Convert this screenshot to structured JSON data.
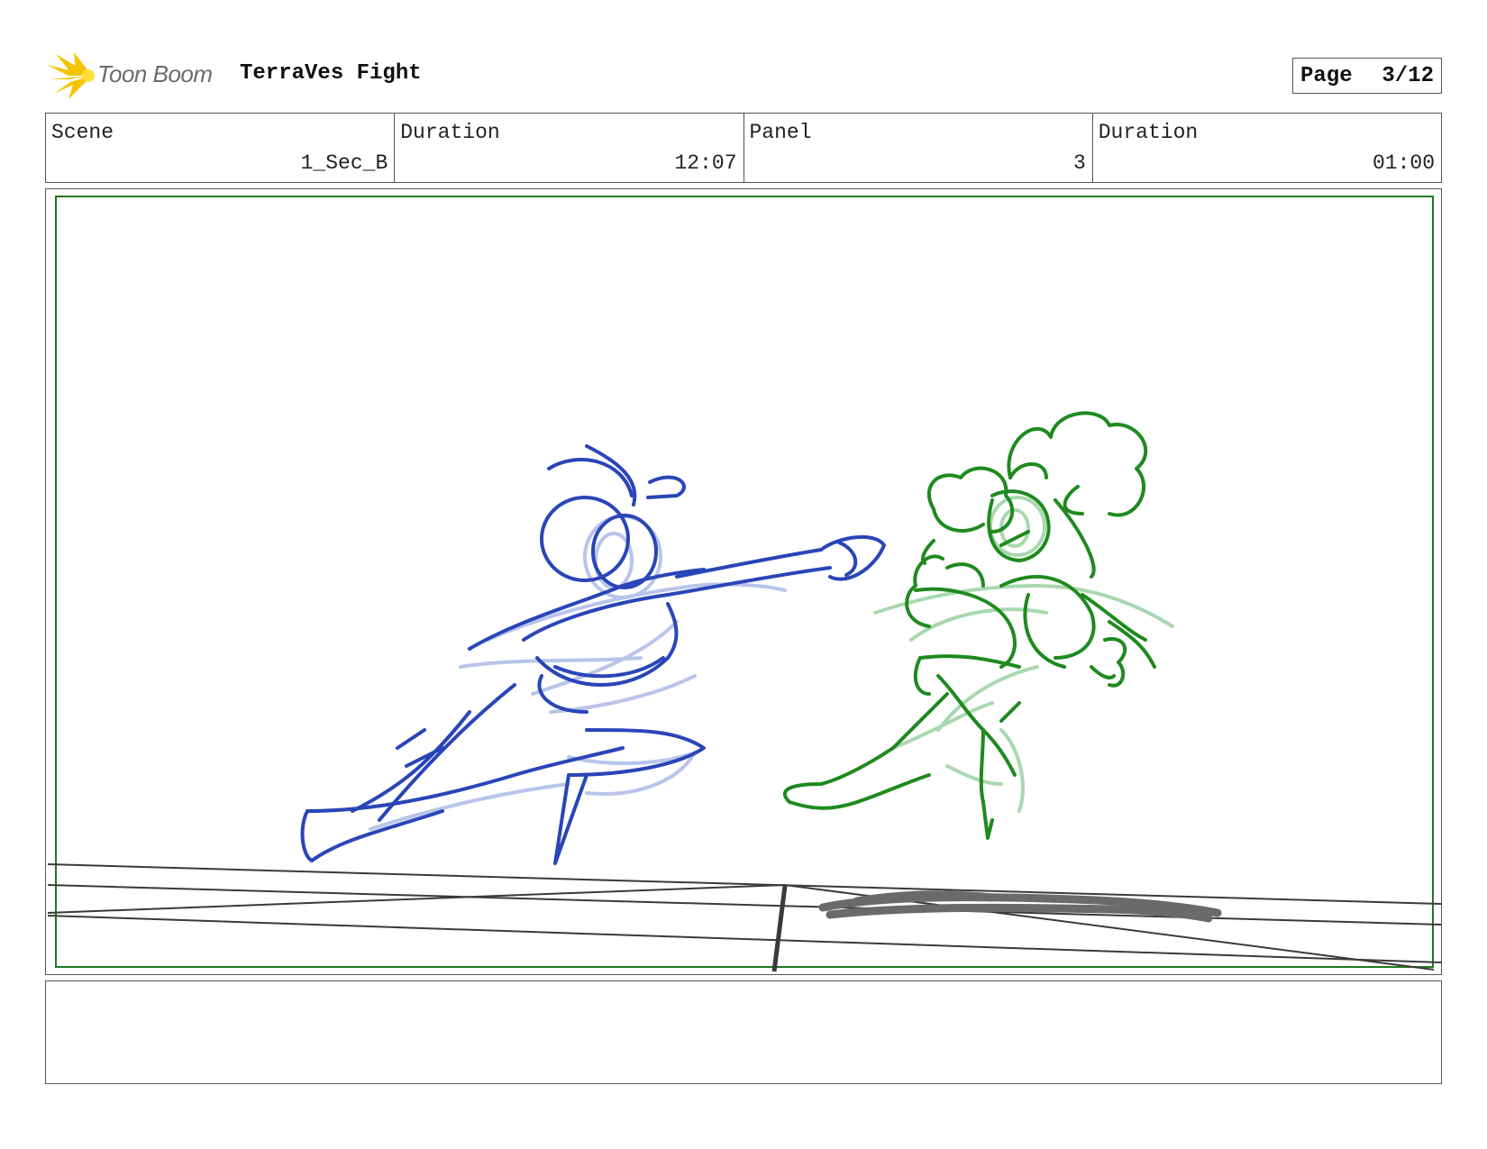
{
  "header": {
    "logo_text": "Toon Boom",
    "project_title": "TerraVes Fight",
    "page_label": "Page",
    "page_value": "3/12"
  },
  "info": {
    "scene_label": "Scene",
    "scene_value": "1_Sec_B",
    "scene_duration_label": "Duration",
    "scene_duration_value": "12:07",
    "panel_label": "Panel",
    "panel_value": "3",
    "panel_duration_label": "Duration",
    "panel_duration_value": "01:00"
  },
  "panel": {
    "safe_frame_color": "#1f7a1f",
    "blue_character_color": "#2a45b8",
    "blue_rough_color": "#b8c4ea",
    "green_character_color": "#1f8a1f",
    "green_rough_color": "#a9d8b0",
    "ground_line_color": "#3a3a3a",
    "shadow_color": "#6a6a6a"
  },
  "notes": {
    "text": ""
  }
}
